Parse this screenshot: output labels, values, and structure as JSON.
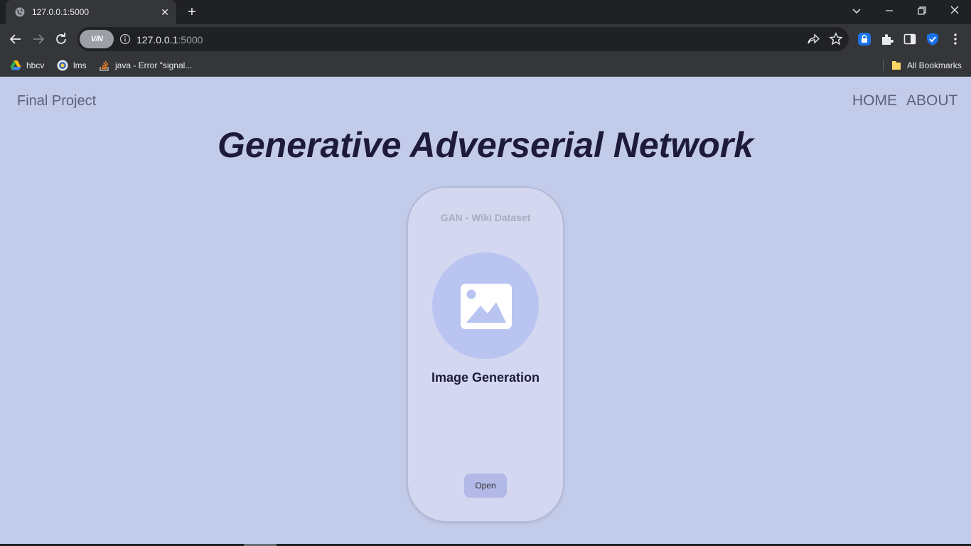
{
  "browser": {
    "tab": {
      "title": "127.0.0.1:5000",
      "icon": "globe-icon"
    },
    "new_tab_label": "+",
    "omnibox": {
      "vpn_label": "V/N",
      "url_host": "127.0.0.1",
      "url_port": ":5000"
    },
    "bookmarks": [
      {
        "label": "hbcv",
        "icon": "google-drive-icon"
      },
      {
        "label": "lms",
        "icon": "lms-logo-icon"
      },
      {
        "label": "java - Error \"signal...",
        "icon": "stackoverflow-icon"
      }
    ],
    "all_bookmarks_label": "All Bookmarks"
  },
  "page": {
    "brand": "Final Project",
    "nav": {
      "home": "HOME",
      "about": "ABOUT"
    },
    "hero_title": "Generative Adverserial Network",
    "card": {
      "subtitle": "GAN - Wiki Dataset",
      "icon": "image-icon",
      "title": "Image Generation",
      "button_label": "Open"
    }
  },
  "colors": {
    "page_bg": "#c3cbeb",
    "card_bg": "#d3d7f0",
    "circle_bg": "#b9c4f1",
    "button_bg": "#b3b9e6",
    "heading": "#1e1b3a"
  }
}
